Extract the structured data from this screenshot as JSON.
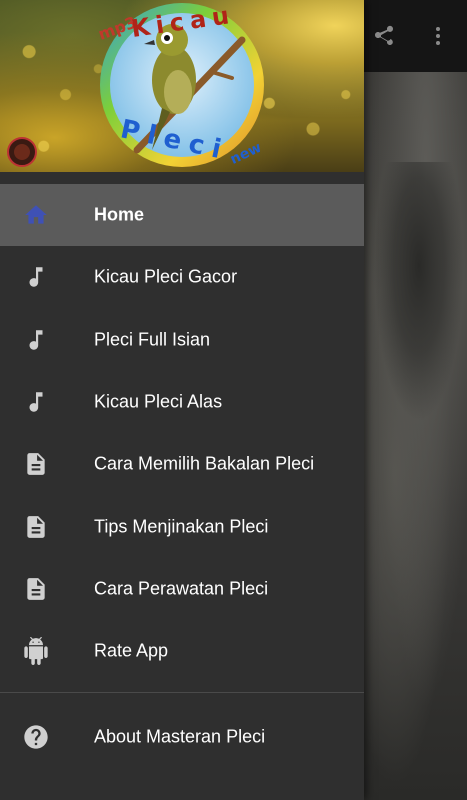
{
  "header": {
    "logo_text_top": "Kicau",
    "logo_text_bottom": "Pleci",
    "logo_badge_mp3": "mp3",
    "logo_badge_new": "new"
  },
  "menu": {
    "items": [
      {
        "label": "Home",
        "icon": "home-icon",
        "active": true
      },
      {
        "label": "Kicau Pleci Gacor",
        "icon": "music-note-icon"
      },
      {
        "label": "Pleci Full Isian",
        "icon": "music-note-icon"
      },
      {
        "label": "Kicau Pleci Alas",
        "icon": "music-note-icon"
      },
      {
        "label": "Cara Memilih Bakalan Pleci",
        "icon": "document-icon"
      },
      {
        "label": "Tips Menjinakan Pleci",
        "icon": "document-icon"
      },
      {
        "label": "Cara Perawatan Pleci",
        "icon": "document-icon"
      },
      {
        "label": "Rate App",
        "icon": "android-icon"
      }
    ],
    "about": {
      "label": "About Masteran Pleci",
      "icon": "help-icon"
    }
  },
  "toolbar": {
    "share_icon": "share-icon",
    "more_icon": "more-vert-icon"
  },
  "colors": {
    "drawer_bg": "#2f2f2f",
    "active_bg": "#5b5b5b",
    "home_icon": "#3f51b5",
    "icon_gray": "#d0d0d0"
  }
}
